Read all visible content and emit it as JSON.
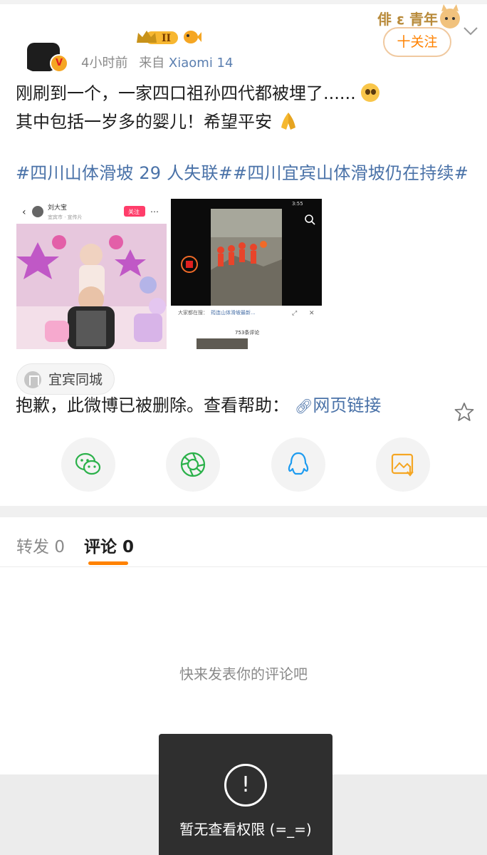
{
  "post": {
    "badge_level": "II",
    "time": "4小时前",
    "source_prefix": "来自",
    "device": "Xiaomi 14",
    "follow_label": "十关注",
    "v_badge": "V",
    "text_line1": "刚刷到一个，一家四口祖孙四代都被埋了......",
    "text_line2": "其中包括一岁多的婴儿！希望平安",
    "hashtags": "#四川山体滑坡 29 人失联##四川宜宾山体滑坡仍在持续#",
    "location": "宜宾同城",
    "deleted_notice": "抱歉，此微博已被删除。查看帮助：",
    "web_link": "网页链接"
  },
  "image1": {
    "username": "刘大宝",
    "follow": "关注",
    "subline": "宜宾市 · 宣传片"
  },
  "image2": {
    "status_time": "3:55",
    "search_prefix": "大家都在搜：",
    "search_term": "筠连山体滑坡最新...",
    "comments_count": "753条评论"
  },
  "share": {
    "wechat": "wechat-icon",
    "moments": "moments-icon",
    "qq": "qq-icon",
    "save": "save-image-icon"
  },
  "tabs": {
    "repost_label": "转发",
    "repost_count": "0",
    "comment_label": "评论",
    "comment_count": "0"
  },
  "comments": {
    "empty_text": "快来发表你的评论吧"
  },
  "toast": {
    "icon": "!",
    "message": "暂无查看权限 (=_=)"
  },
  "colors": {
    "accent": "#ff8200",
    "link": "#4a72a8",
    "meta": "#8a8a8a"
  }
}
